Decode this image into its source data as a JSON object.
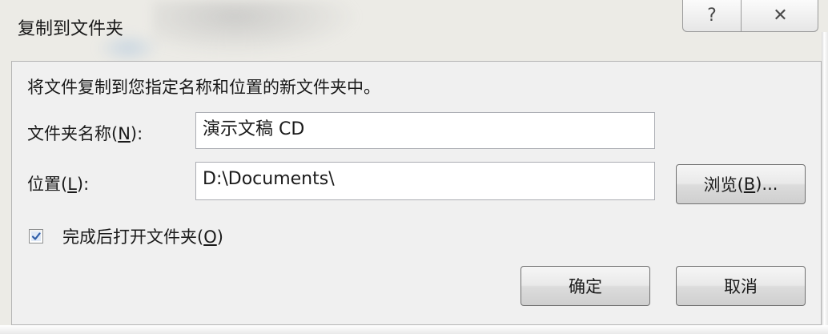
{
  "dialog": {
    "title": "复制到文件夹",
    "help_symbol": "?",
    "close_symbol": "✕",
    "description": "将文件复制到您指定名称和位置的新文件夹中。"
  },
  "fields": {
    "folder_name": {
      "label_prefix": "文件夹名称(",
      "label_accel": "N",
      "label_suffix": "):",
      "value": "演示文稿 CD"
    },
    "location": {
      "label_prefix": "位置(",
      "label_accel": "L",
      "label_suffix": "):",
      "value": "D:\\Documents\\"
    }
  },
  "browse_button": {
    "prefix": "浏览(",
    "accel": "B",
    "suffix": ")..."
  },
  "open_after": {
    "checked": true,
    "prefix": "完成后打开文件夹(",
    "accel": "O",
    "suffix": ")"
  },
  "buttons": {
    "ok": "确定",
    "cancel": "取消"
  }
}
